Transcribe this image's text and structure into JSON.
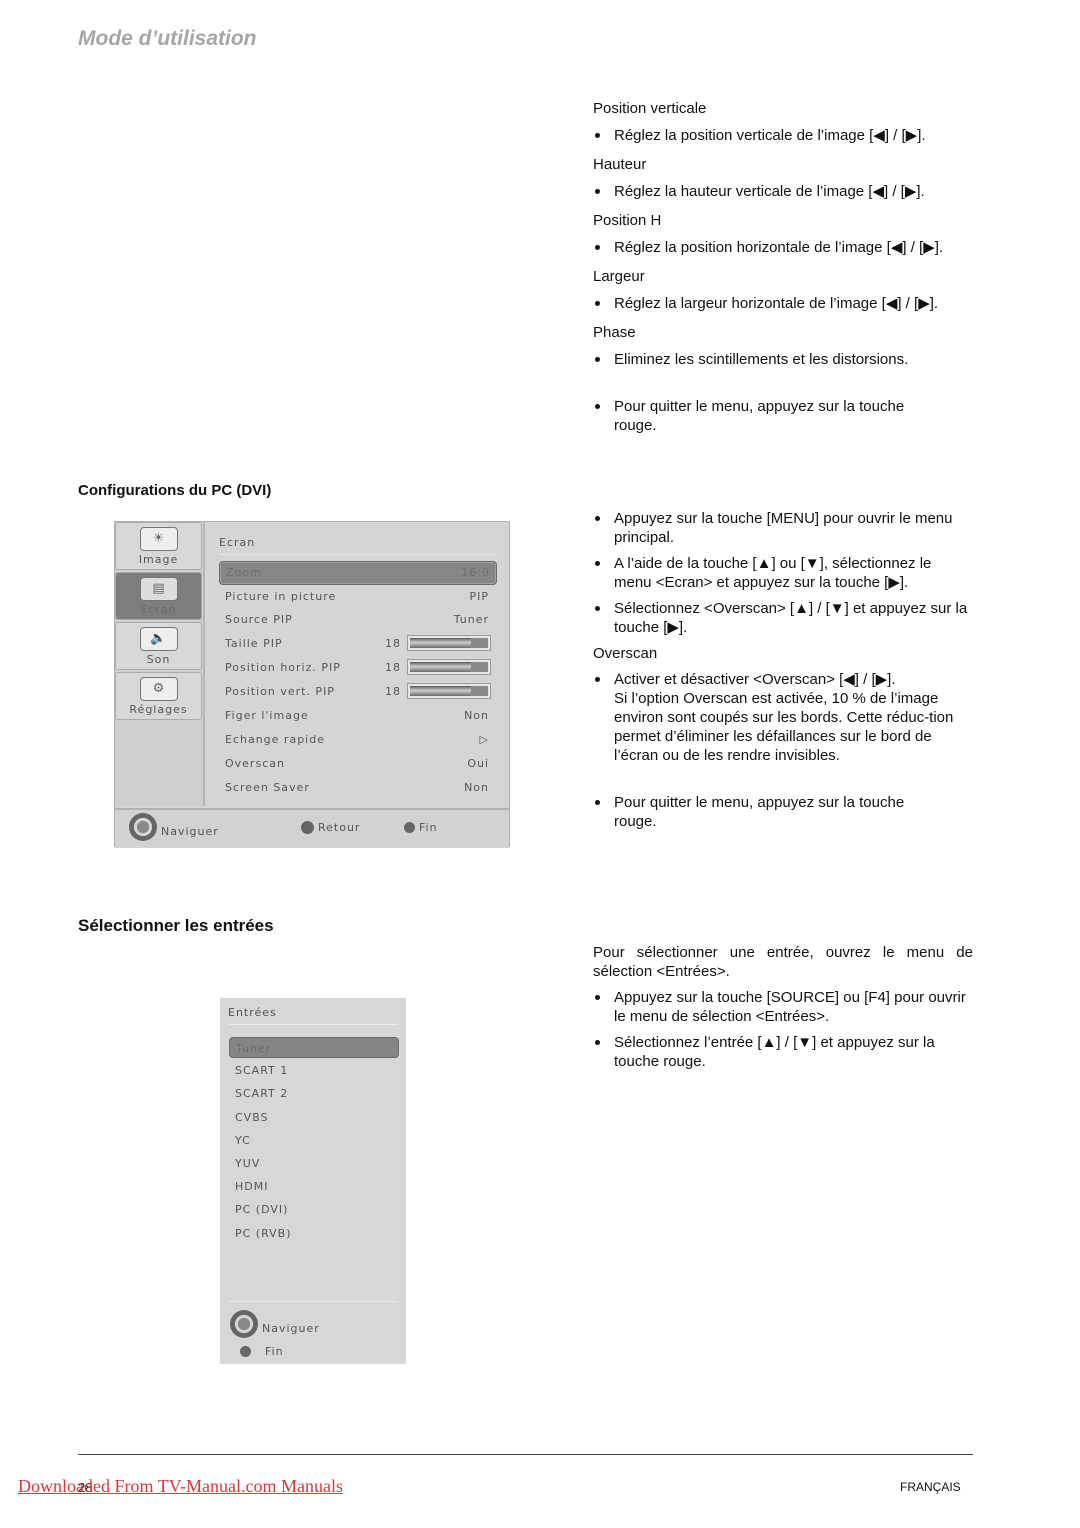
{
  "header": {
    "title": "Mode d’utilisation"
  },
  "right_top": {
    "items": [
      {
        "type": "sub",
        "text": "Position verticale"
      },
      {
        "type": "bullet",
        "text": "Réglez la position verticale de l’image [◀] / [▶]."
      },
      {
        "type": "sub",
        "text": "Hauteur"
      },
      {
        "type": "bullet",
        "text": "Réglez la hauteur verticale de l’image [◀] / [▶]."
      },
      {
        "type": "sub",
        "text": "Position H"
      },
      {
        "type": "bullet",
        "text": "Réglez la position horizontale de l’image [◀] / [▶]."
      },
      {
        "type": "sub",
        "text": "Largeur"
      },
      {
        "type": "bullet",
        "text": "Réglez la largeur horizontale de l’image [◀] / [▶]."
      },
      {
        "type": "sub",
        "text": "Phase"
      },
      {
        "type": "bullet",
        "text": "Eliminez les scintillements et les distorsions."
      },
      {
        "type": "bullet",
        "text": "Pour quitter le menu, appuyez sur la touche rouge."
      }
    ]
  },
  "section_pc": {
    "heading": "Configurations du PC (DVI)",
    "steps": [
      "Appuyez sur la touche [MENU] pour ouvrir le menu principal.",
      "A l’aide de la touche [▲] ou [▼], sélectionnez le menu <Ecran> et appuyez sur la touche [▶].",
      "Sélectionnez <Overscan> [▲] / [▼] et appuyez sur la touche [▶]."
    ],
    "overscan_title": "Overscan",
    "overscan_bullet_line1": "Activer et désactiver <Overscan> [◀] / [▶].",
    "overscan_bullet_rest": "Si l’option Overscan est activée, 10 % de l’image environ sont coupés sur les bords. Cette réduc-tion permet d’éliminer les défaillances sur le bord de l’écran ou de les rendre invisibles.",
    "quit": "Pour quitter le menu, appuyez sur la touche rouge."
  },
  "osd_menu": {
    "sidebar": [
      {
        "label": "Image",
        "icon": "☀",
        "active": false
      },
      {
        "label": "Ecran",
        "icon": "▤",
        "active": true
      },
      {
        "label": "Son",
        "icon": "🔈",
        "active": false
      },
      {
        "label": "Réglages",
        "icon": "⚙",
        "active": false
      }
    ],
    "title": "Ecran",
    "rows": [
      {
        "label": "Zoom",
        "value": "16:9",
        "selected": true
      },
      {
        "label": "Picture in picture",
        "value": "PIP"
      },
      {
        "label": "Source PIP",
        "value": "Tuner"
      },
      {
        "label": "Taille PIP",
        "number": "18",
        "slider_fraction": 0.78
      },
      {
        "label": "Position horiz. PIP",
        "number": "18",
        "slider_fraction": 0.78
      },
      {
        "label": "Position vert. PIP",
        "number": "18",
        "slider_fraction": 0.78
      },
      {
        "label": "Figer l'image",
        "value": "Non"
      },
      {
        "label": "Echange rapide",
        "value": "▷"
      },
      {
        "label": "Overscan",
        "value": "Oui"
      },
      {
        "label": "Screen Saver",
        "value": "Non"
      }
    ],
    "footer": {
      "navigate": "Naviguer",
      "back": "Retour",
      "back_icon": "RET",
      "end": "Fin"
    }
  },
  "section_inputs": {
    "heading": "Sélectionner les entrées",
    "intro": "Pour sélectionner une entrée, ouvrez le menu de sélection <Entrées>.",
    "steps": [
      "Appuyez sur la touche [SOURCE] ou [F4] pour ouvrir le menu de sélection <Entrées>.",
      "Sélectionnez l’entrée [▲] / [▼] et appuyez sur la touche rouge."
    ]
  },
  "inputs_menu": {
    "title": "Entrées",
    "items": [
      "Tuner",
      "SCART 1",
      "SCART 2",
      "CVBS",
      "YC",
      "YUV",
      "HDMI",
      "PC (DVI)",
      "PC (RVB)"
    ],
    "selected_index": 0,
    "footer": {
      "navigate": "Naviguer",
      "end": "Fin"
    }
  },
  "footer": {
    "page_number": "28",
    "language": "FRANÇAIS",
    "download_link": "Downloaded From TV-Manual.com Manuals"
  }
}
